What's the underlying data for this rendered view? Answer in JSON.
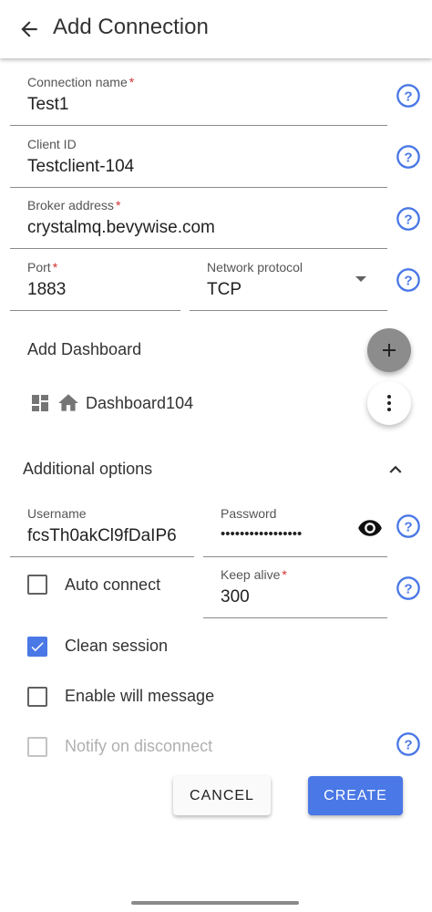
{
  "appbar": {
    "title": "Add Connection",
    "back_icon": "arrow-left-icon"
  },
  "connection_name": {
    "label": "Connection name",
    "required": "*",
    "value": "Test1"
  },
  "client_id": {
    "label": "Client ID",
    "value": "Testclient-104"
  },
  "broker_address": {
    "label": "Broker address",
    "required": "*",
    "value": "crystalmq.bevywise.com"
  },
  "port": {
    "label": "Port",
    "required": "*",
    "value": "1883"
  },
  "network_protocol": {
    "label": "Network protocol",
    "value": "TCP"
  },
  "dashboard": {
    "section_title": "Add Dashboard",
    "item_name": "Dashboard104"
  },
  "additional": {
    "section_title": "Additional options"
  },
  "username": {
    "label": "Username",
    "value": "fcsTh0akCl9fDaIP6"
  },
  "password": {
    "label": "Password",
    "value": "•••••••••••••••••"
  },
  "keep_alive": {
    "label": "Keep alive",
    "required": "*",
    "value": "300"
  },
  "checkboxes": {
    "auto_connect": {
      "label": "Auto connect",
      "checked": false
    },
    "clean_session": {
      "label": "Clean session",
      "checked": true
    },
    "will_message": {
      "label": "Enable will message",
      "checked": false
    },
    "notify_disconnect": {
      "label": "Notify on disconnect",
      "checked": false,
      "disabled": true
    }
  },
  "buttons": {
    "cancel": "CANCEL",
    "create": "CREATE"
  },
  "colors": {
    "accent": "#4a78e6",
    "required": "#d32f2f",
    "fab": "#8c8c8c"
  }
}
